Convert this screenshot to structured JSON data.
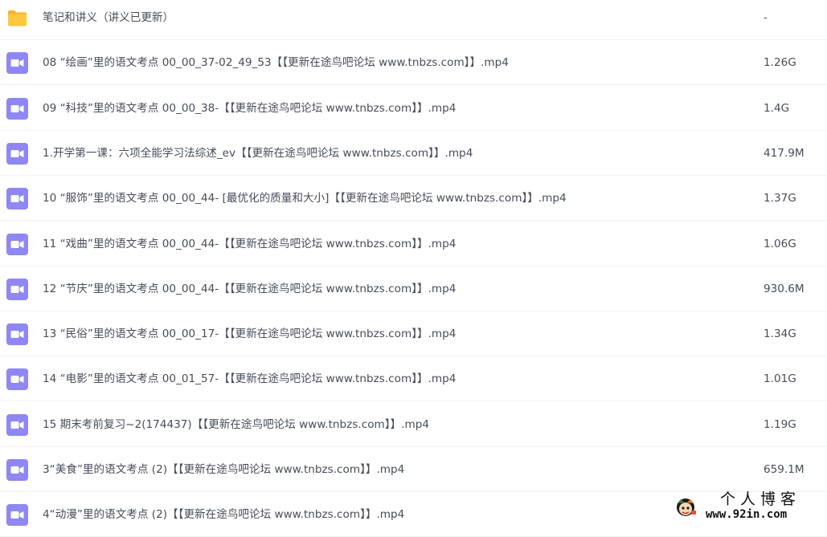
{
  "files": [
    {
      "type": "folder",
      "icon": "folder-icon",
      "name": "笔记和讲义（讲义已更新）",
      "size": "-"
    },
    {
      "type": "video",
      "icon": "video-file-icon",
      "name": "08 “绘画”里的语文考点 00_00_37-02_49_53【【更新在途鸟吧论坛 www.tnbzs.com】】.mp4",
      "size": "1.26G"
    },
    {
      "type": "video",
      "icon": "video-file-icon",
      "name": "09 “科技”里的语文考点 00_00_38-【【更新在途鸟吧论坛 www.tnbzs.com】】.mp4",
      "size": "1.4G"
    },
    {
      "type": "video",
      "icon": "video-file-icon",
      "name": "1.开学第一课：六项全能学习法综述_ev【【更新在途鸟吧论坛 www.tnbzs.com】】.mp4",
      "size": "417.9M"
    },
    {
      "type": "video",
      "icon": "video-file-icon",
      "name": "10 “服饰”里的语文考点 00_00_44- [最优化的质量和大小]【【更新在途鸟吧论坛 www.tnbzs.com】】.mp4",
      "size": "1.37G"
    },
    {
      "type": "video",
      "icon": "video-file-icon",
      "name": "11 “戏曲”里的语文考点 00_00_44-【【更新在途鸟吧论坛 www.tnbzs.com】】.mp4",
      "size": "1.06G"
    },
    {
      "type": "video",
      "icon": "video-file-icon",
      "name": "12 “节庆”里的语文考点 00_00_44-【【更新在途鸟吧论坛 www.tnbzs.com】】.mp4",
      "size": "930.6M"
    },
    {
      "type": "video",
      "icon": "video-file-icon",
      "name": "13 “民俗”里的语文考点 00_00_17-【【更新在途鸟吧论坛 www.tnbzs.com】】.mp4",
      "size": "1.34G"
    },
    {
      "type": "video",
      "icon": "video-file-icon",
      "name": "14 “电影”里的语文考点 00_01_57-【【更新在途鸟吧论坛 www.tnbzs.com】】.mp4",
      "size": "1.01G"
    },
    {
      "type": "video",
      "icon": "video-file-icon",
      "name": "15 期末考前复习~2(174437)【【更新在途鸟吧论坛 www.tnbzs.com】】.mp4",
      "size": "1.19G"
    },
    {
      "type": "video",
      "icon": "video-file-icon",
      "name": "3“美食”里的语文考点 (2)【【更新在途鸟吧论坛 www.tnbzs.com】】.mp4",
      "size": "659.1M"
    },
    {
      "type": "video",
      "icon": "video-file-icon",
      "name": "4“动漫”里的语文考点 (2)【【更新在途鸟吧论坛 www.tnbzs.com】】.mp4",
      "size": ""
    }
  ],
  "watermark": {
    "title": "个人博客",
    "url": "www.92in.com",
    "avatar_icon": "cartoon-avatar-icon"
  },
  "colors": {
    "folder": "#ffc63f",
    "folder_tab": "#f5b22a",
    "video": "#8f87f5",
    "text": "#454d5a",
    "divider": "#f1f2f4"
  }
}
